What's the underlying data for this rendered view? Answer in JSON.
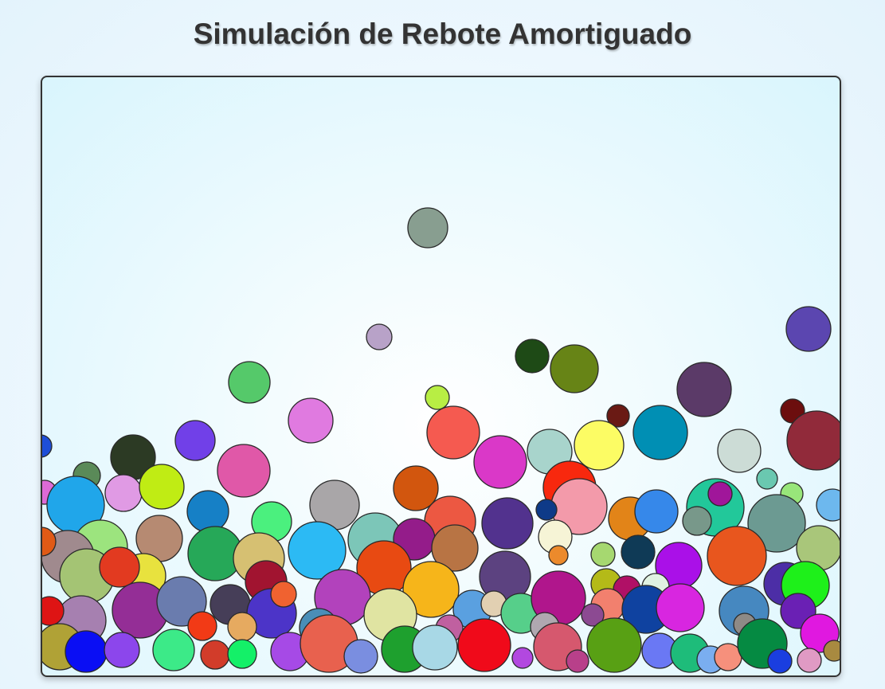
{
  "title": "Simulación de Rebote Amortiguado",
  "stage": {
    "balls": [
      [
        "#5a9a5a",
        "#2c3a24",
        "#89a193"
      ],
      [
        "#c0a2c8",
        "#55a4cf",
        "#55d66d"
      ]
    ]
  }
}
